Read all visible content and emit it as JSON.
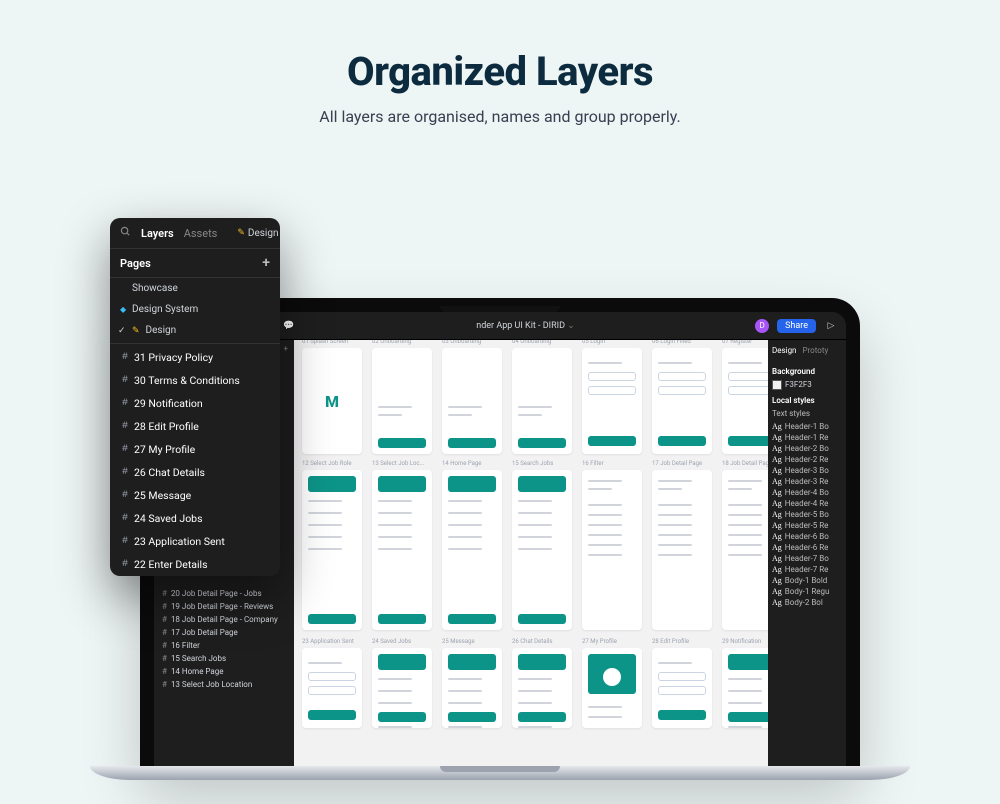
{
  "hero": {
    "title": "Organized Layers",
    "subtitle": "All layers are organised, names and group properly."
  },
  "figma": {
    "document_title": "nder App UI Kit - DIRID",
    "share_label": "Share",
    "avatar_letter": "D",
    "secondary_sidebar_page_prefix": "gn",
    "inner_left_frames": [
      "20 Job Detail Page - Jobs",
      "19 Job Detail Page - Reviews",
      "18 Job Detail Page - Company",
      "17 Job Detail Page",
      "16 Filter",
      "15 Search Jobs",
      "14 Home Page",
      "13 Select Job Location"
    ],
    "right_panel": {
      "tabs": [
        "Design",
        "Prototy"
      ],
      "background_label": "Background",
      "background_value": "F3F2F3",
      "local_styles_label": "Local styles",
      "text_styles_label": "Text styles",
      "styles": [
        "Header-1 Bo",
        "Header-1 Re",
        "Header-2 Bo",
        "Header-2 Re",
        "Header-3 Bo",
        "Header-3 Re",
        "Header-4 Bo",
        "Header-4 Re",
        "Header-5 Bo",
        "Header-5 Re",
        "Header-6 Bo",
        "Header-6 Re",
        "Header-7 Bo",
        "Header-7 Re",
        "Body-1 Bold",
        "Body-1 Regu",
        "Body-2 Bol"
      ]
    },
    "canvas_row1": [
      "01 Splash Screen",
      "02 Onboarding",
      "03 Onboarding",
      "04 Onboarding",
      "05 Login",
      "06 Login Filled",
      "07 Register"
    ],
    "canvas_row2": [
      "12 Select Job Role",
      "13 Select Job Loc...",
      "14 Home Page",
      "15 Search Jobs",
      "16 Filter",
      "17 Job Detail Page",
      "18 Job Detail Pag"
    ],
    "canvas_row3": [
      "23 Application Sent",
      "24 Saved Jobs",
      "25 Message",
      "26 Chat Details",
      "27 My Profile",
      "28 Edit Profile",
      "29 Notification"
    ]
  },
  "layers_panel": {
    "tab_layers": "Layers",
    "tab_assets": "Assets",
    "page_select_label": "Design",
    "pages_header": "Pages",
    "pages": [
      {
        "name": "Showcase",
        "icon": "none"
      },
      {
        "name": "Design System",
        "icon": "diamond"
      },
      {
        "name": "Design",
        "icon": "checked"
      }
    ],
    "frames": [
      "31 Privacy Policy",
      "30 Terms & Conditions",
      "29 Notification",
      "28 Edit Profile",
      "27 My Profile",
      "26 Chat Details",
      "25 Message",
      "24 Saved Jobs",
      "23 Application Sent",
      "22 Enter Details"
    ]
  }
}
